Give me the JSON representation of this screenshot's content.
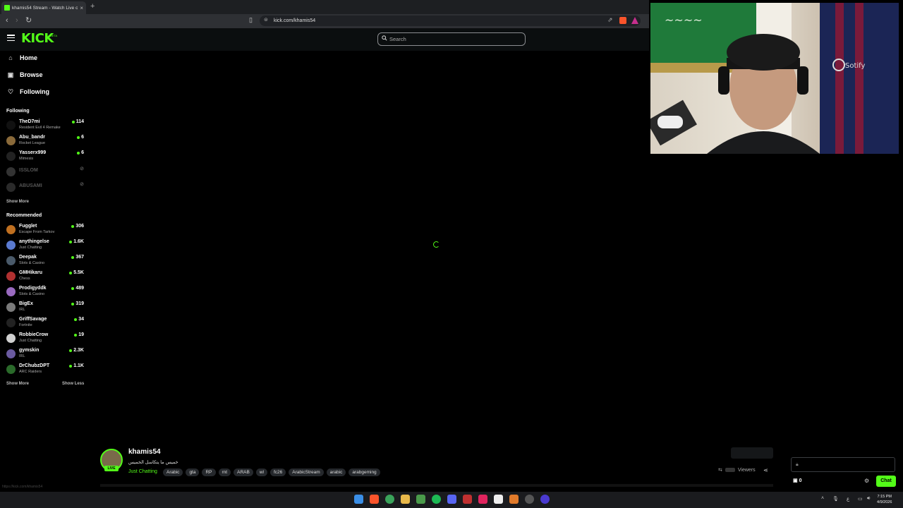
{
  "browser": {
    "tab_title": "khamis54 Stream - Watch Live o",
    "url": "kick.com/khamis54"
  },
  "kick": {
    "logo": "KICK",
    "beta": "BETA",
    "search_placeholder": "Search",
    "nav": [
      {
        "label": "Home",
        "icon": "home-icon"
      },
      {
        "label": "Browse",
        "icon": "browse-icon"
      },
      {
        "label": "Following",
        "icon": "heart-icon"
      }
    ],
    "following_title": "Following",
    "following": [
      {
        "name": "TheD7mi",
        "category": "Resident Evil 4 Remake",
        "viewers": "114",
        "avatar_color": "#111111"
      },
      {
        "name": "Abu_bandr",
        "category": "Rocket League",
        "viewers": "6",
        "avatar_color": "#8a6a3a"
      },
      {
        "name": "Yasserx999",
        "category": "Mimesis",
        "viewers": "6",
        "avatar_color": "#222222"
      },
      {
        "name": "ISSLOM",
        "category": "",
        "viewers": "",
        "avatar_color": "#333333"
      },
      {
        "name": "ABUSAMI",
        "category": "",
        "viewers": "",
        "avatar_color": "#2a2a2a"
      }
    ],
    "show_more": "Show More",
    "recommended_title": "Recommended",
    "recommended": [
      {
        "name": "Fugglet",
        "category": "Escape From Tarkov",
        "viewers": "306",
        "avatar_color": "#c07020"
      },
      {
        "name": "anythingelse",
        "category": "Just Chatting",
        "viewers": "1.6K",
        "avatar_color": "#5a7ad0"
      },
      {
        "name": "Deepak",
        "category": "Slots & Casino",
        "viewers": "367",
        "avatar_color": "#4a5a6a"
      },
      {
        "name": "GMHikaru",
        "category": "Chess",
        "viewers": "5.5K",
        "avatar_color": "#b03030"
      },
      {
        "name": "Prodigyddk",
        "category": "Slots & Casino",
        "viewers": "489",
        "avatar_color": "#9a6ac0"
      },
      {
        "name": "BigEx",
        "category": "IRL",
        "viewers": "319",
        "avatar_color": "#7a7a7a"
      },
      {
        "name": "GriffSavage",
        "category": "Fortnite",
        "viewers": "34",
        "avatar_color": "#222222"
      },
      {
        "name": "RobbieCrow",
        "category": "Just Chatting",
        "viewers": "19",
        "avatar_color": "#d0d0d0"
      },
      {
        "name": "gymskin",
        "category": "IRL",
        "viewers": "2.3K",
        "avatar_color": "#6a5aa0"
      },
      {
        "name": "DrChubzDPT",
        "category": "ARC Raiders",
        "viewers": "1.1K",
        "avatar_color": "#2a6a2a"
      }
    ],
    "show_less": "Show Less"
  },
  "stream": {
    "streamer": "khamis54",
    "live_label": "LIVE",
    "title": "خميس ما يتكاسل الخميس",
    "category": "Just Chatting",
    "tags": [
      "Arabic",
      "gta",
      "RP",
      "rnt",
      "ARAB",
      "wl",
      "fc26",
      "ArabicStream",
      "arabic",
      "arabgeming"
    ],
    "viewers_label": "Viewers"
  },
  "chat": {
    "points": "0",
    "button": "Chat"
  },
  "status_url": "https://kick.com/khamis54",
  "taskbar": {
    "time": "7:15 PM",
    "date": "4/9/2026",
    "lang": "ع"
  }
}
